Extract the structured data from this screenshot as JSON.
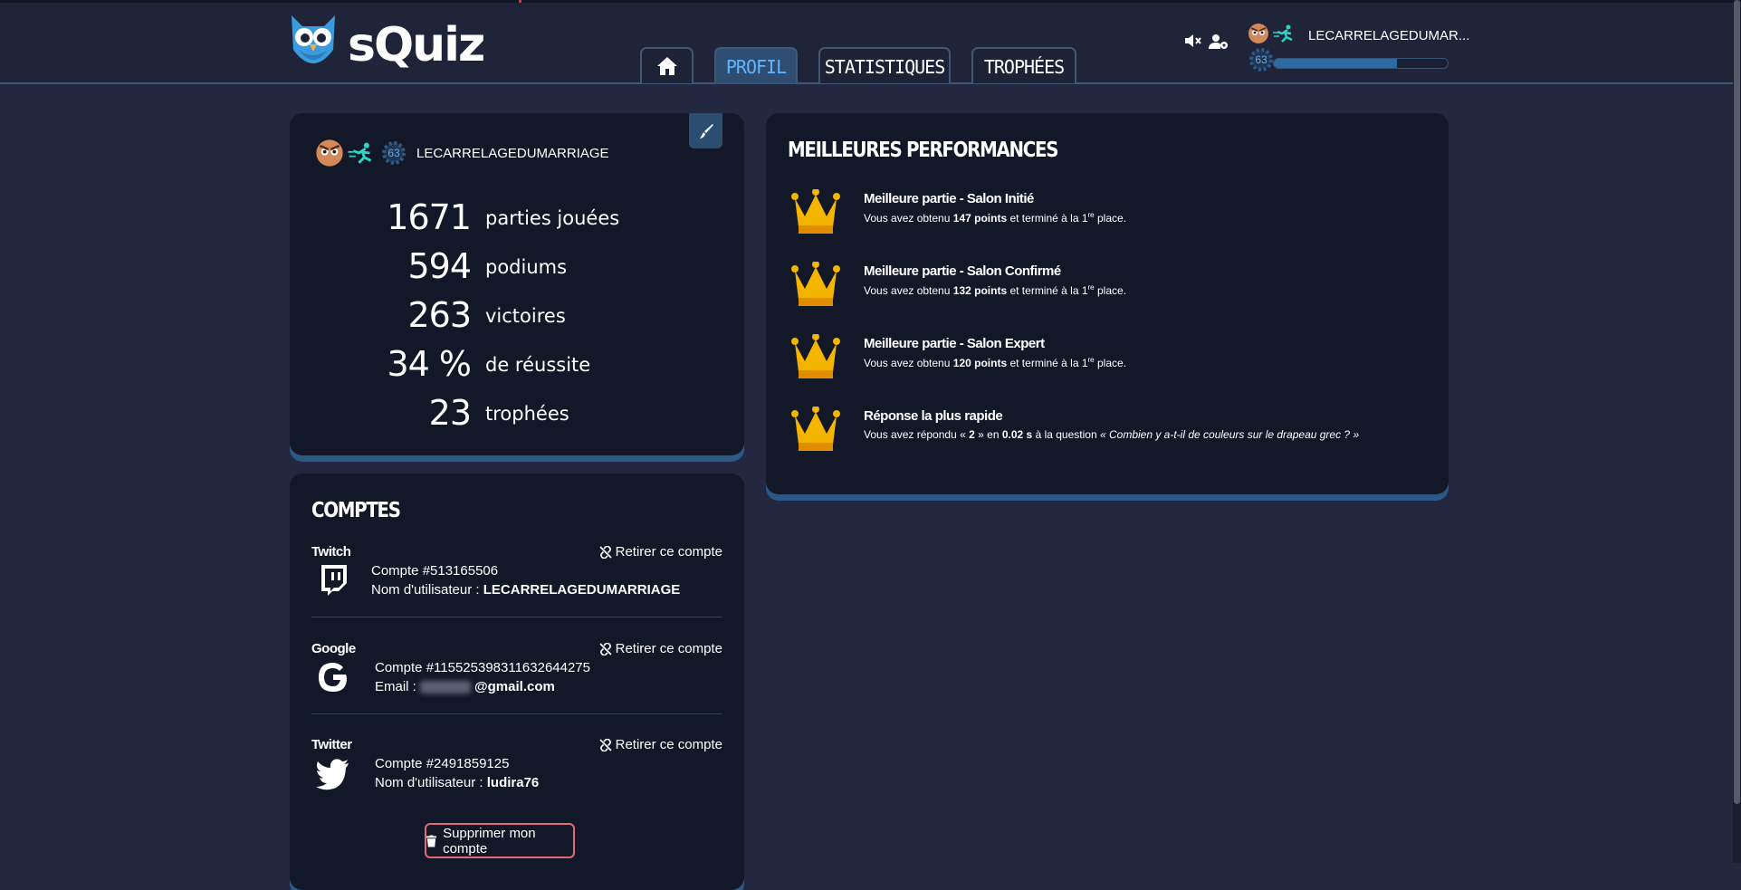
{
  "brand": {
    "name": "sQuiz"
  },
  "nav": {
    "tabs": [
      {
        "label": "PROFIL"
      },
      {
        "label": "STATISTIQUES"
      },
      {
        "label": "TROPHÉES"
      }
    ]
  },
  "header_user": {
    "name": "LECARRELAGEDUMAR...",
    "level": "63",
    "xp_fraction": 0.71
  },
  "profile": {
    "username": "LECARRELAGEDUMARRIAGE",
    "level": "63",
    "stats": [
      {
        "value": "1671",
        "label": "parties jouées"
      },
      {
        "value": "594",
        "label": "podiums"
      },
      {
        "value": "263",
        "label": "victoires"
      },
      {
        "value": "34 %",
        "label": "de réussite"
      },
      {
        "value": "23",
        "label": "trophées"
      }
    ]
  },
  "accounts": {
    "title": "COMPTES",
    "remove_label": "Retirer ce compte",
    "twitch": {
      "provider": "Twitch",
      "account": "Compte #513165506",
      "field_label": "Nom d'utilisateur :",
      "field_value": "LECARRELAGEDUMARRIAGE"
    },
    "google": {
      "provider": "Google",
      "account": "Compte #115525398311632644275",
      "field_label": "Email :",
      "field_value": "@gmail.com"
    },
    "twitter": {
      "provider": "Twitter",
      "account": "Compte #2491859125",
      "field_label": "Nom d'utilisateur :",
      "field_value": "ludira76"
    },
    "delete_label": "Supprimer mon compte"
  },
  "performances": {
    "title": "MEILLEURES PERFORMANCES",
    "items": [
      {
        "title": "Meilleure partie - Salon Initié",
        "pre": "Vous avez obtenu",
        "points": "147 points",
        "mid": "et terminé à la 1",
        "sup": "re",
        "post": "place."
      },
      {
        "title": "Meilleure partie - Salon Confirmé",
        "pre": "Vous avez obtenu",
        "points": "132 points",
        "mid": "et terminé à la 1",
        "sup": "re",
        "post": "place."
      },
      {
        "title": "Meilleure partie - Salon Expert",
        "pre": "Vous avez obtenu",
        "points": "120 points",
        "mid": "et terminé à la 1",
        "sup": "re",
        "post": "place."
      }
    ],
    "fastest": {
      "title": "Réponse la plus rapide",
      "pre": "Vous avez répondu «",
      "answer": "2",
      "mid": "» en",
      "time": "0.02 s",
      "post": "à la question",
      "question": "« Combien y a-t-il de couleurs sur le drapeau grec ? »"
    }
  },
  "colors": {
    "accent": "#5fb8ff",
    "card": "#131828",
    "background": "#232840",
    "crown": "#f5b400",
    "danger": "#e06a75"
  }
}
